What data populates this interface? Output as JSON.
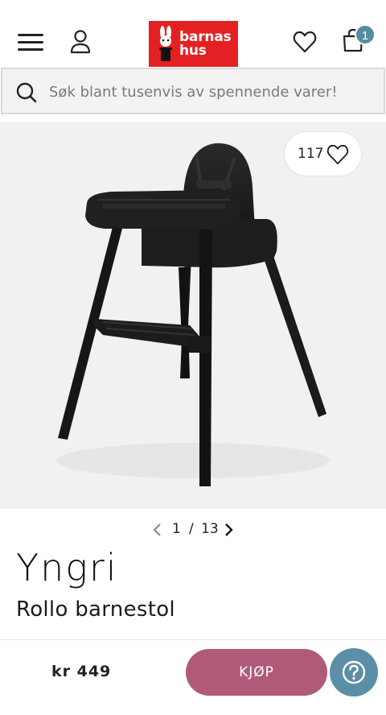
{
  "header": {
    "logo_line1": "barnas",
    "logo_line2": "hus",
    "cart_count": "1",
    "brand_color": "#e42122"
  },
  "search": {
    "placeholder": "Søk blant tusenvis av spennende varer!"
  },
  "gallery": {
    "likes": "117",
    "current": "1",
    "separator": "/",
    "total": "13"
  },
  "product": {
    "brand": "Yngri",
    "title": "Rollo barnestol",
    "price": "kr 449",
    "buy_label": "KJØP"
  },
  "colors": {
    "buy_button": "#b05a79",
    "help_button": "#5d8ea8",
    "badge": "#5a8aa0"
  },
  "icons": [
    "hamburger-menu-icon",
    "user-icon",
    "heart-icon",
    "cart-icon",
    "search-icon",
    "chevron-left-icon",
    "chevron-right-icon",
    "question-icon"
  ]
}
